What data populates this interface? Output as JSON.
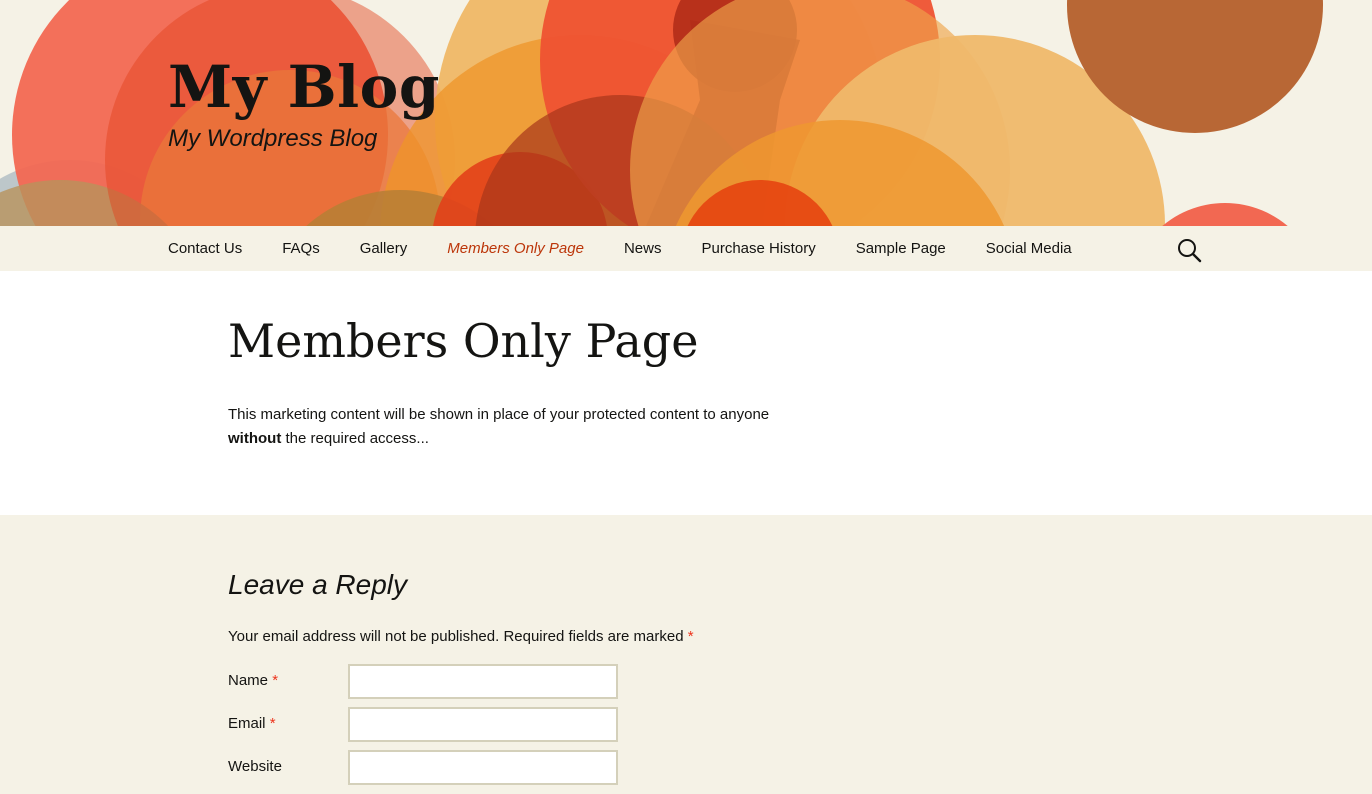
{
  "site": {
    "title": "My Blog",
    "tagline": "My Wordpress Blog"
  },
  "nav": {
    "items": [
      {
        "label": "Contact Us",
        "active": false
      },
      {
        "label": "FAQs",
        "active": false
      },
      {
        "label": "Gallery",
        "active": false
      },
      {
        "label": "Members Only Page",
        "active": true
      },
      {
        "label": "News",
        "active": false
      },
      {
        "label": "Purchase History",
        "active": false
      },
      {
        "label": "Sample Page",
        "active": false
      },
      {
        "label": "Social Media",
        "active": false
      }
    ],
    "search_icon": "search-icon"
  },
  "page": {
    "title": "Members Only Page",
    "text_part1": "This marketing content will be shown in place of your protected content to anyone",
    "text_bold": "without",
    "text_part2": " the required access..."
  },
  "comments": {
    "title": "Leave a Reply",
    "notes": "Your email address will not be published. Required fields are marked",
    "required_mark": "*",
    "fields": {
      "name_label": "Name",
      "email_label": "Email",
      "website_label": "Website",
      "name_value": "",
      "email_value": "",
      "website_value": ""
    }
  },
  "colors": {
    "accent": "#bc360a",
    "required": "#ed331c",
    "background": "#f5f2e6"
  }
}
